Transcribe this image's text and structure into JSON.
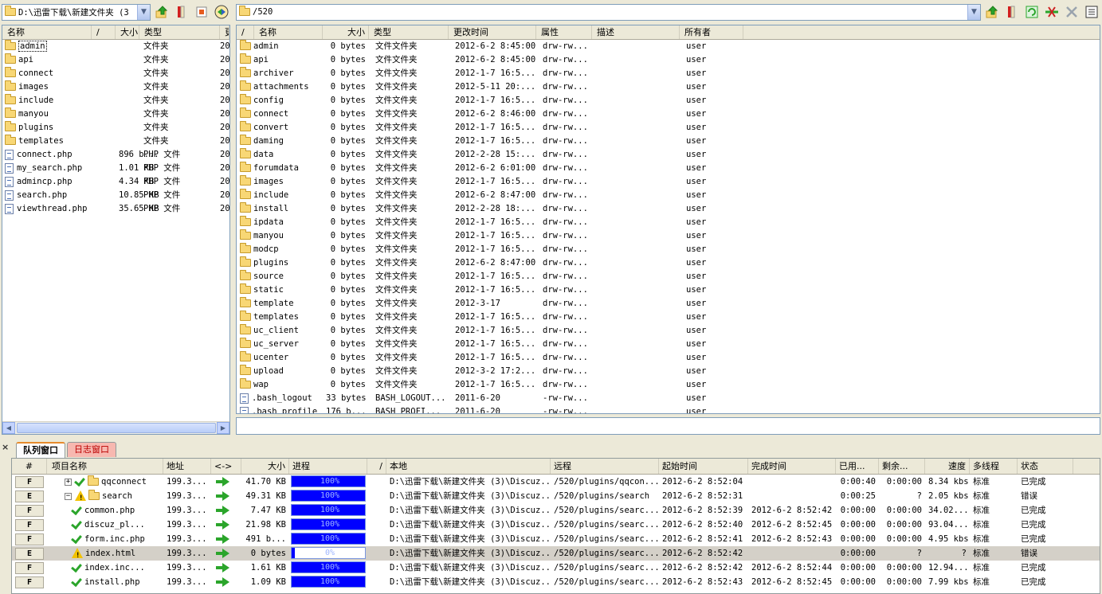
{
  "left": {
    "path": "D:\\迅雷下载\\新建文件夹 (3",
    "headers": {
      "name": "名称",
      "sort": "/",
      "size": "大小",
      "type": "类型",
      "mod": "更"
    },
    "rows": [
      {
        "name": "admin",
        "kind": "folder",
        "size": "",
        "type": "文件夹",
        "mod": "20"
      },
      {
        "name": "api",
        "kind": "folder",
        "size": "",
        "type": "文件夹",
        "mod": "20"
      },
      {
        "name": "connect",
        "kind": "folder",
        "size": "",
        "type": "文件夹",
        "mod": "20"
      },
      {
        "name": "images",
        "kind": "folder",
        "size": "",
        "type": "文件夹",
        "mod": "20"
      },
      {
        "name": "include",
        "kind": "folder",
        "size": "",
        "type": "文件夹",
        "mod": "20"
      },
      {
        "name": "manyou",
        "kind": "folder",
        "size": "",
        "type": "文件夹",
        "mod": "20"
      },
      {
        "name": "plugins",
        "kind": "folder",
        "size": "",
        "type": "文件夹",
        "mod": "20"
      },
      {
        "name": "templates",
        "kind": "folder",
        "size": "",
        "type": "文件夹",
        "mod": "20"
      },
      {
        "name": "connect.php",
        "kind": "file",
        "size": "896 b...",
        "type": "PHP 文件",
        "mod": "20"
      },
      {
        "name": "my_search.php",
        "kind": "file",
        "size": "1.01 KB",
        "type": "PHP 文件",
        "mod": "20"
      },
      {
        "name": "admincp.php",
        "kind": "file",
        "size": "4.34 KB",
        "type": "PHP 文件",
        "mod": "20"
      },
      {
        "name": "search.php",
        "kind": "file",
        "size": "10.85 KB",
        "type": "PHP 文件",
        "mod": "20"
      },
      {
        "name": "viewthread.php",
        "kind": "file",
        "size": "35.65 KB",
        "type": "PHP 文件",
        "mod": "20"
      }
    ]
  },
  "right": {
    "path": "/520",
    "headers": {
      "sort": "/",
      "name": "名称",
      "size": "大小",
      "type": "类型",
      "mod": "更改时间",
      "attr": "属性",
      "desc": "描述",
      "owner": "所有者"
    },
    "rows": [
      {
        "name": "admin",
        "kind": "folder",
        "size": "0 bytes",
        "type": "文件文件夹",
        "mod": "2012-6-2 8:45:00",
        "attr": "drw-rw...",
        "owner": "user"
      },
      {
        "name": "api",
        "kind": "folder",
        "size": "0 bytes",
        "type": "文件文件夹",
        "mod": "2012-6-2 8:45:00",
        "attr": "drw-rw...",
        "owner": "user"
      },
      {
        "name": "archiver",
        "kind": "folder",
        "size": "0 bytes",
        "type": "文件文件夹",
        "mod": "2012-1-7 16:5...",
        "attr": "drw-rw...",
        "owner": "user"
      },
      {
        "name": "attachments",
        "kind": "folder",
        "size": "0 bytes",
        "type": "文件文件夹",
        "mod": "2012-5-11 20:...",
        "attr": "drw-rw...",
        "owner": "user"
      },
      {
        "name": "config",
        "kind": "folder",
        "size": "0 bytes",
        "type": "文件文件夹",
        "mod": "2012-1-7 16:5...",
        "attr": "drw-rw...",
        "owner": "user"
      },
      {
        "name": "connect",
        "kind": "folder",
        "size": "0 bytes",
        "type": "文件文件夹",
        "mod": "2012-6-2 8:46:00",
        "attr": "drw-rw...",
        "owner": "user"
      },
      {
        "name": "convert",
        "kind": "folder",
        "size": "0 bytes",
        "type": "文件文件夹",
        "mod": "2012-1-7 16:5...",
        "attr": "drw-rw...",
        "owner": "user"
      },
      {
        "name": "daming",
        "kind": "folder",
        "size": "0 bytes",
        "type": "文件文件夹",
        "mod": "2012-1-7 16:5...",
        "attr": "drw-rw...",
        "owner": "user"
      },
      {
        "name": "data",
        "kind": "folder",
        "size": "0 bytes",
        "type": "文件文件夹",
        "mod": "2012-2-28 15:...",
        "attr": "drw-rw...",
        "owner": "user"
      },
      {
        "name": "forumdata",
        "kind": "folder",
        "size": "0 bytes",
        "type": "文件文件夹",
        "mod": "2012-6-2 6:01:00",
        "attr": "drw-rw...",
        "owner": "user"
      },
      {
        "name": "images",
        "kind": "folder",
        "size": "0 bytes",
        "type": "文件文件夹",
        "mod": "2012-1-7 16:5...",
        "attr": "drw-rw...",
        "owner": "user"
      },
      {
        "name": "include",
        "kind": "folder",
        "size": "0 bytes",
        "type": "文件文件夹",
        "mod": "2012-6-2 8:47:00",
        "attr": "drw-rw...",
        "owner": "user"
      },
      {
        "name": "install",
        "kind": "folder",
        "size": "0 bytes",
        "type": "文件文件夹",
        "mod": "2012-2-28 18:...",
        "attr": "drw-rw...",
        "owner": "user"
      },
      {
        "name": "ipdata",
        "kind": "folder",
        "size": "0 bytes",
        "type": "文件文件夹",
        "mod": "2012-1-7 16:5...",
        "attr": "drw-rw...",
        "owner": "user"
      },
      {
        "name": "manyou",
        "kind": "folder",
        "size": "0 bytes",
        "type": "文件文件夹",
        "mod": "2012-1-7 16:5...",
        "attr": "drw-rw...",
        "owner": "user"
      },
      {
        "name": "modcp",
        "kind": "folder",
        "size": "0 bytes",
        "type": "文件文件夹",
        "mod": "2012-1-7 16:5...",
        "attr": "drw-rw...",
        "owner": "user"
      },
      {
        "name": "plugins",
        "kind": "folder",
        "size": "0 bytes",
        "type": "文件文件夹",
        "mod": "2012-6-2 8:47:00",
        "attr": "drw-rw...",
        "owner": "user"
      },
      {
        "name": "source",
        "kind": "folder",
        "size": "0 bytes",
        "type": "文件文件夹",
        "mod": "2012-1-7 16:5...",
        "attr": "drw-rw...",
        "owner": "user"
      },
      {
        "name": "static",
        "kind": "folder",
        "size": "0 bytes",
        "type": "文件文件夹",
        "mod": "2012-1-7 16:5...",
        "attr": "drw-rw...",
        "owner": "user"
      },
      {
        "name": "template",
        "kind": "folder",
        "size": "0 bytes",
        "type": "文件文件夹",
        "mod": "2012-3-17",
        "attr": "drw-rw...",
        "owner": "user"
      },
      {
        "name": "templates",
        "kind": "folder",
        "size": "0 bytes",
        "type": "文件文件夹",
        "mod": "2012-1-7 16:5...",
        "attr": "drw-rw...",
        "owner": "user"
      },
      {
        "name": "uc_client",
        "kind": "folder",
        "size": "0 bytes",
        "type": "文件文件夹",
        "mod": "2012-1-7 16:5...",
        "attr": "drw-rw...",
        "owner": "user"
      },
      {
        "name": "uc_server",
        "kind": "folder",
        "size": "0 bytes",
        "type": "文件文件夹",
        "mod": "2012-1-7 16:5...",
        "attr": "drw-rw...",
        "owner": "user"
      },
      {
        "name": "ucenter",
        "kind": "folder",
        "size": "0 bytes",
        "type": "文件文件夹",
        "mod": "2012-1-7 16:5...",
        "attr": "drw-rw...",
        "owner": "user"
      },
      {
        "name": "upload",
        "kind": "folder",
        "size": "0 bytes",
        "type": "文件文件夹",
        "mod": "2012-3-2 17:2...",
        "attr": "drw-rw...",
        "owner": "user"
      },
      {
        "name": "wap",
        "kind": "folder",
        "size": "0 bytes",
        "type": "文件文件夹",
        "mod": "2012-1-7 16:5...",
        "attr": "drw-rw...",
        "owner": "user"
      },
      {
        "name": ".bash_logout",
        "kind": "file",
        "size": "33 bytes",
        "type": "BASH_LOGOUT...",
        "mod": "2011-6-20",
        "attr": "-rw-rw...",
        "owner": "user"
      },
      {
        "name": ".bash_profile",
        "kind": "file",
        "size": "176 b...",
        "type": "BASH_PROFI...",
        "mod": "2011-6-20",
        "attr": "-rw-rw...",
        "owner": "user"
      }
    ]
  },
  "queue": {
    "tabs": {
      "queue": "队列窗口",
      "log": "日志窗口"
    },
    "headers": {
      "idx": "#",
      "name": "项目名称",
      "addr": "地址",
      "dir": "<->",
      "size": "大小",
      "progress": "进程",
      "sort": "/",
      "local": "本地",
      "remote": "远程",
      "start": "起始时间",
      "end": "完成时间",
      "used": "已用...",
      "remain": "剩余...",
      "speed": "速度",
      "threads": "多线程",
      "status": "状态"
    },
    "rows": [
      {
        "idx": "F",
        "level": 0,
        "tree": "+",
        "mark": "check",
        "folder": true,
        "name": "qqconnect",
        "addr": "199.3...",
        "size": "41.70 KB",
        "pct": 100,
        "pct_label": "100%",
        "local": "D:\\迅雷下载\\新建文件夹 (3)\\Discuz...",
        "remote": "/520/plugins/qqcon...",
        "start": "2012-6-2 8:52:04",
        "end": "",
        "used": "0:00:40",
        "remain": "0:00:00",
        "speed": "8.34 kbs",
        "threads": "标准",
        "status": "已完成",
        "selected": false
      },
      {
        "idx": "E",
        "level": 0,
        "tree": "−",
        "mark": "warn",
        "folder": true,
        "name": "search",
        "addr": "199.3...",
        "size": "49.31 KB",
        "pct": 100,
        "pct_label": "100%",
        "local": "D:\\迅雷下载\\新建文件夹 (3)\\Discuz...",
        "remote": "/520/plugins/search",
        "start": "2012-6-2 8:52:31",
        "end": "",
        "used": "0:00:25",
        "remain": "?",
        "speed": "2.05 kbs",
        "threads": "标准",
        "status": "错误",
        "selected": false
      },
      {
        "idx": "F",
        "level": 1,
        "tree": "",
        "mark": "check",
        "folder": false,
        "name": "common.php",
        "addr": "199.3...",
        "size": "7.47 KB",
        "pct": 100,
        "pct_label": "100%",
        "local": "D:\\迅雷下载\\新建文件夹 (3)\\Discuz...",
        "remote": "/520/plugins/searc...",
        "start": "2012-6-2 8:52:39",
        "end": "2012-6-2 8:52:42",
        "used": "0:00:00",
        "remain": "0:00:00",
        "speed": "34.02...",
        "threads": "标准",
        "status": "已完成",
        "selected": false
      },
      {
        "idx": "F",
        "level": 1,
        "tree": "",
        "mark": "check",
        "folder": false,
        "name": "discuz_pl...",
        "addr": "199.3...",
        "size": "21.98 KB",
        "pct": 100,
        "pct_label": "100%",
        "local": "D:\\迅雷下载\\新建文件夹 (3)\\Discuz...",
        "remote": "/520/plugins/searc...",
        "start": "2012-6-2 8:52:40",
        "end": "2012-6-2 8:52:45",
        "used": "0:00:00",
        "remain": "0:00:00",
        "speed": "93.04...",
        "threads": "标准",
        "status": "已完成",
        "selected": false
      },
      {
        "idx": "F",
        "level": 1,
        "tree": "",
        "mark": "check",
        "folder": false,
        "name": "form.inc.php",
        "addr": "199.3...",
        "size": "491 b...",
        "pct": 100,
        "pct_label": "100%",
        "local": "D:\\迅雷下载\\新建文件夹 (3)\\Discuz...",
        "remote": "/520/plugins/searc...",
        "start": "2012-6-2 8:52:41",
        "end": "2012-6-2 8:52:43",
        "used": "0:00:00",
        "remain": "0:00:00",
        "speed": "4.95 kbs",
        "threads": "标准",
        "status": "已完成",
        "selected": false
      },
      {
        "idx": "E",
        "level": 1,
        "tree": "",
        "mark": "warn",
        "folder": false,
        "name": "index.html",
        "addr": "199.3...",
        "size": "0 bytes",
        "pct": 0,
        "pct_label": "0%",
        "local": "D:\\迅雷下载\\新建文件夹 (3)\\Discuz...",
        "remote": "/520/plugins/searc...",
        "start": "2012-6-2 8:52:42",
        "end": "",
        "used": "0:00:00",
        "remain": "?",
        "speed": "?",
        "threads": "标准",
        "status": "错误",
        "selected": true
      },
      {
        "idx": "F",
        "level": 1,
        "tree": "",
        "mark": "check",
        "folder": false,
        "name": "index.inc...",
        "addr": "199.3...",
        "size": "1.61 KB",
        "pct": 100,
        "pct_label": "100%",
        "local": "D:\\迅雷下载\\新建文件夹 (3)\\Discuz...",
        "remote": "/520/plugins/searc...",
        "start": "2012-6-2 8:52:42",
        "end": "2012-6-2 8:52:44",
        "used": "0:00:00",
        "remain": "0:00:00",
        "speed": "12.94...",
        "threads": "标准",
        "status": "已完成",
        "selected": false
      },
      {
        "idx": "F",
        "level": 1,
        "tree": "",
        "mark": "check",
        "folder": false,
        "name": "install.php",
        "addr": "199.3...",
        "size": "1.09 KB",
        "pct": 100,
        "pct_label": "100%",
        "local": "D:\\迅雷下载\\新建文件夹 (3)\\Discuz...",
        "remote": "/520/plugins/searc...",
        "start": "2012-6-2 8:52:43",
        "end": "2012-6-2 8:52:45",
        "used": "0:00:00",
        "remain": "0:00:00",
        "speed": "7.99 kbs",
        "threads": "标准",
        "status": "已完成",
        "selected": false
      }
    ]
  },
  "colors": {
    "progress_fill": "#0000ff",
    "check": "#2ba52b",
    "warn": "#f2c200",
    "folder": "#f8d775"
  },
  "icons": {
    "up": "up-folder-icon",
    "bookmark": "bookmark-icon",
    "refresh": "refresh-icon",
    "stop": "stop-icon",
    "disconnect": "disconnect-icon",
    "menu": "menu-icon"
  }
}
